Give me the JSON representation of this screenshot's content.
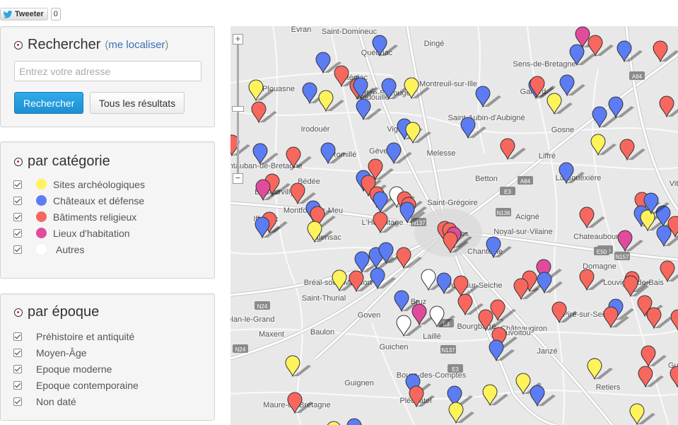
{
  "tweet": {
    "label": "Tweeter",
    "count": "0"
  },
  "search": {
    "title": "Rechercher",
    "locate_prefix": "(",
    "locate_link": "me localiser",
    "locate_suffix": ")",
    "placeholder": "Entrez votre adresse",
    "search_button": "Rechercher",
    "all_button": "Tous les résultats"
  },
  "category": {
    "title": "par catégorie",
    "items": [
      {
        "label": "Sites archéologiques",
        "color": "#fff35c"
      },
      {
        "label": "Châteaux et défense",
        "color": "#5c7cf4"
      },
      {
        "label": "Bâtiments religieux",
        "color": "#f7675e"
      },
      {
        "label": "Lieux d'habitation",
        "color": "#e04c9b"
      },
      {
        "label": "Autres",
        "color": "#ffffff"
      }
    ]
  },
  "epoch": {
    "title": "par époque",
    "items": [
      {
        "label": "Préhistoire et antiquité"
      },
      {
        "label": "Moyen-Âge"
      },
      {
        "label": "Epoque moderne"
      },
      {
        "label": "Epoque contemporaine"
      },
      {
        "label": "Non daté"
      }
    ]
  },
  "map": {
    "zoom_in": "+",
    "zoom_out": "−",
    "places": [
      "Evran",
      "Saint-Domineuc",
      "Québriac",
      "Dingé",
      "Tinténiac",
      "Sens-de-Bretagne",
      "Plouasne",
      "Montreuil-sur-Ille",
      "Gahard",
      "Bédée-Bazouges",
      "Andouillé",
      "Saint-Aubin-d'Aubigné",
      "Gosne",
      "Irodouër",
      "Vignoc",
      "Romillé",
      "Gévezé",
      "Melesse",
      "Liffré",
      "Montauban-de-Bretagne",
      "Bédée",
      "La Bouëxière",
      "Betton",
      "Vitré",
      "Saint-Grégoire",
      "Boisgervilly",
      "Montfort-sur-Meu",
      "Iffendic",
      "Acigné",
      "L'Hermitage",
      "Rennes",
      "Noyal-sur-Vilaine",
      "Talensac",
      "Chateaubourg",
      "Chantepie",
      "Domagne",
      "Bréal-sous-Montfort",
      "Vern-sur-Seiche",
      "Louvigné-de-Bais",
      "Saint-Thurial",
      "Bruz",
      "Goven",
      "Bais",
      "Plélan-le-Grand",
      "Châteaugiron",
      "Nouvoitou",
      "Bourgbarré",
      "Piré-sur-Seiche",
      "Maxent",
      "Baulon",
      "Laillé",
      "Guichen",
      "Janzé",
      "Guerche",
      "Bourg-des-Comptes",
      "Guignen",
      "Pléchâtel",
      "Retiers",
      "Maure-de-Bretagne"
    ],
    "roads": [
      "A84",
      "N136",
      "E3",
      "A84",
      "N137",
      "E50",
      "N157",
      "E50",
      "N24",
      "E3",
      "N24",
      "N137",
      "E3"
    ]
  }
}
